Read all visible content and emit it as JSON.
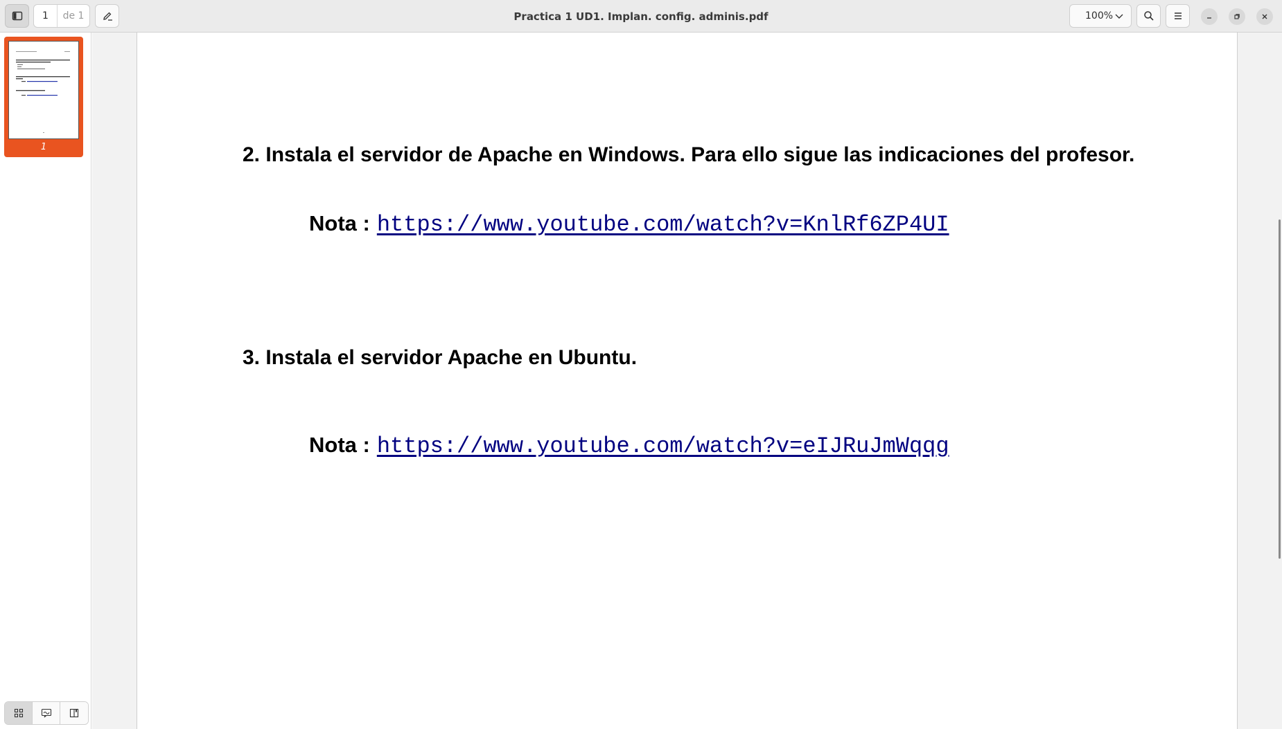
{
  "header": {
    "sidebar_toggle_icon": "sidebar-icon",
    "page_current": "1",
    "page_of": "de 1",
    "annotate_icon": "pen-icon",
    "title": "Practica 1 UD1. Implan. config. adminis.pdf",
    "zoom": "100%",
    "search_icon": "search-icon",
    "menu_icon": "hamburger-icon",
    "window_controls": [
      "minimize-icon",
      "restore-icon",
      "close-icon"
    ]
  },
  "sidebar": {
    "thumbnails": [
      {
        "label": "1",
        "selected": true
      }
    ],
    "tools": [
      "thumbnails-grid-icon",
      "annotations-icon",
      "bookmarks-icon"
    ]
  },
  "document": {
    "question2": "2. Instala el servidor de Apache en Windows. Para ello sigue las indicaciones del profesor.",
    "note1_label": "Nota :",
    "note1_link": "https://www.youtube.com/watch?v=KnlRf6ZP4UI",
    "question3": "3. Instala el servidor Apache en Ubuntu.",
    "note2_label": "Nota :",
    "note2_link": "https://www.youtube.com/watch?v=eIJRuJmWqqg"
  },
  "colors": {
    "accent": "#e95420",
    "link": "#000080"
  }
}
